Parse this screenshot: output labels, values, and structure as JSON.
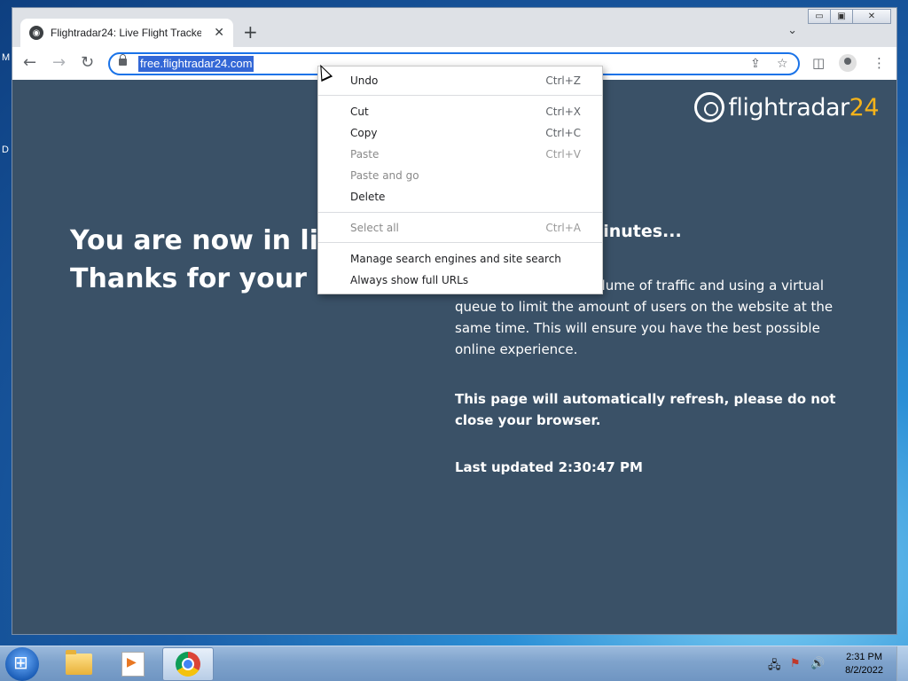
{
  "desktop": {
    "labels": [
      "M",
      "D"
    ]
  },
  "window": {
    "caption": {
      "minimize": "▭",
      "maximize": "▣",
      "close": "✕"
    }
  },
  "tab": {
    "title": "Flightradar24: Live Flight Tracker",
    "favicon": "globe-icon",
    "close": "✕"
  },
  "newtab": "+",
  "tabsearch": "⌄",
  "toolbar": {
    "back": "←",
    "forward": "→",
    "reload": "↻",
    "url": "free.flightradar24.com",
    "share": "⇪",
    "star": "☆",
    "sidebar": "◫",
    "menu": "⋮"
  },
  "page": {
    "logo_text": "flightradar",
    "logo_num": "24",
    "headline_1": "You are now in line",
    "headline_2": "Thanks for your pa",
    "wait": "ait time is 25 minutes...",
    "para": "high volume of traffic and using a virtual queue to limit the amount of users on the website at the same time. This will ensure you have the best possible online experience.",
    "refresh": "This page will automatically refresh, please do not close your browser.",
    "updated": "Last updated 2:30:47 PM"
  },
  "context_menu": {
    "items": [
      {
        "label": "Undo",
        "shortcut": "Ctrl+Z",
        "disabled": false
      },
      {
        "label": "Cut",
        "shortcut": "Ctrl+X",
        "disabled": false
      },
      {
        "label": "Copy",
        "shortcut": "Ctrl+C",
        "disabled": false
      },
      {
        "label": "Paste",
        "shortcut": "Ctrl+V",
        "disabled": true
      },
      {
        "label": "Paste and go",
        "shortcut": "",
        "disabled": true
      },
      {
        "label": "Delete",
        "shortcut": "",
        "disabled": false
      },
      {
        "label": "Select all",
        "shortcut": "Ctrl+A",
        "disabled": true
      },
      {
        "label": "Manage search engines and site search",
        "shortcut": "",
        "disabled": false
      },
      {
        "label": "Always show full URLs",
        "shortcut": "",
        "disabled": false
      }
    ]
  },
  "taskbar": {
    "apps": [
      "windows-explorer",
      "media-player",
      "google-chrome"
    ],
    "tray": {
      "network": "🖧",
      "flag": "⚑",
      "volume": "🔊"
    },
    "clock_time": "2:31 PM",
    "clock_date": "8/2/2022"
  },
  "colors": {
    "page_bg": "#3a5167",
    "accent": "#1a73e8",
    "logo_accent": "#f5b31a"
  }
}
